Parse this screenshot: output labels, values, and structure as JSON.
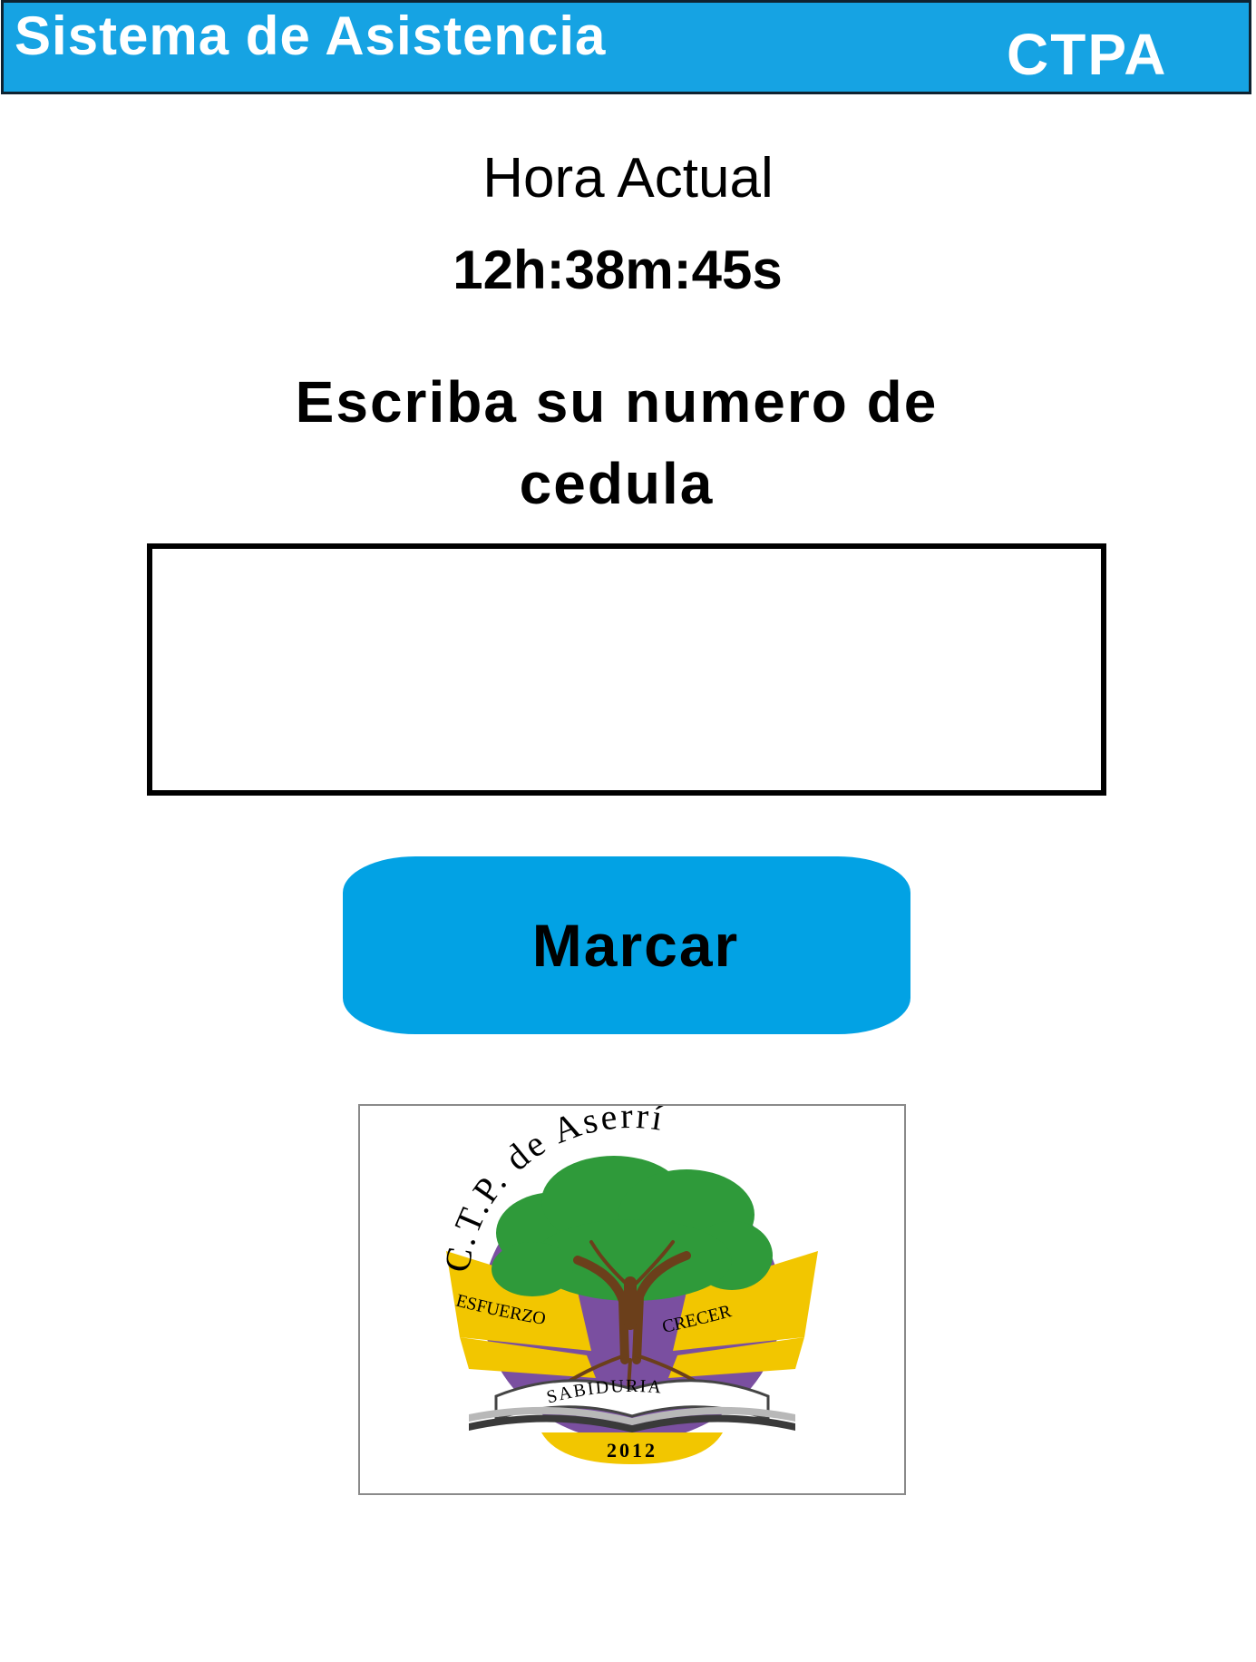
{
  "header": {
    "title": "Sistema de Asistencia",
    "brand": "CTPA"
  },
  "clock": {
    "label": "Hora Actual",
    "time": "12h:38m:45s"
  },
  "form": {
    "instruction_line1": "Escriba su numero de",
    "instruction_line2": "cedula",
    "id_value": "",
    "submit_label": "Marcar"
  },
  "logo": {
    "arc_text": "C.T.P. de Aserrí",
    "left_banner": "ESFUERZO",
    "right_banner": "CRECER",
    "book_text": "SABIDURIA",
    "year": "2012"
  },
  "colors": {
    "header_bg": "#16a3e3",
    "button_bg": "#02a2e4",
    "logo_purple": "#7a4fa0",
    "logo_green": "#2f9a3a",
    "logo_gold": "#f2c600",
    "logo_trunk": "#6b3f1b"
  }
}
